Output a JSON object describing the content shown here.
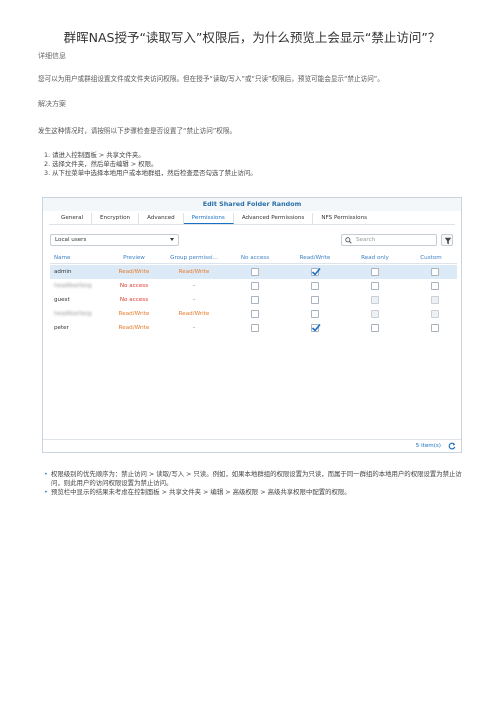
{
  "title": "群晖NAS授予“读取写入”权限后，为什么预览上会显示“禁止访问”？",
  "details_heading": "详细信息",
  "details_text": "您可以为用户或群组设置文件或文件夹访问权限。但在授予“读取/写入”或“只读”权限后，预览可能会显示“禁止访问”。",
  "solution_heading": "解决方案",
  "solution_text": "发生这种情况时，请按照以下步骤检查是否设置了“禁止访问”权限。",
  "steps": [
    "1. 请进入控制面板 > 共享文件夹。",
    "2. 选择文件夹，然后单击编辑 > 权限。",
    "3. 从下拉菜单中选择本地用户或本地群组，然后检查是否勾选了禁止访问。"
  ],
  "dialog": {
    "title": "Edit Shared Folder Random",
    "tabs": [
      "General",
      "Encryption",
      "Advanced",
      "Permissions",
      "Advanced Permissions",
      "NFS Permissions"
    ],
    "active_tab": "Permissions",
    "select_value": "Local users",
    "search_placeholder": "Search",
    "columns": [
      "Name",
      "Preview",
      "Group permissi...",
      "No access",
      "Read/Write",
      "Read only",
      "Custom"
    ],
    "rows": [
      {
        "name": "admin",
        "preview": "Read/Write",
        "group": "Read/Write",
        "no_access": false,
        "read_write": true,
        "read_only": false,
        "custom": false,
        "selected": true,
        "disabled": false
      },
      {
        "name": "headfearfang",
        "preview": "No access",
        "group": "-",
        "no_access": false,
        "read_write": false,
        "read_only": false,
        "custom": false,
        "selected": false,
        "disabled": false,
        "blurred": true
      },
      {
        "name": "guest",
        "preview": "No access",
        "group": "-",
        "no_access": false,
        "read_write": false,
        "read_only": false,
        "custom": false,
        "selected": false,
        "disabled": true
      },
      {
        "name": "headfearfang",
        "preview": "Read/Write",
        "group": "Read/Write",
        "no_access": false,
        "read_write": false,
        "read_only": false,
        "custom": false,
        "selected": false,
        "disabled": true,
        "blurred": true
      },
      {
        "name": "peter",
        "preview": "Read/Write",
        "group": "-",
        "no_access": false,
        "read_write": true,
        "read_only": false,
        "custom": false,
        "selected": false,
        "disabled": false
      }
    ],
    "items_count": "5 item(s)"
  },
  "bullets": [
    "权限级别的优先顺序为：禁止访问 > 读取/写入 > 只读。例如，如果本地群组的权限设置为只读，而属于同一群组的本地用户的权限设置为禁止访问，则此用户的访问权限设置为禁止访问。",
    "预览栏中显示的结果未考虑在控制面板 > 共享文件夹 > 编辑 > 高级权限 > 高级共享权限中配置的权限。"
  ],
  "colors": {
    "accent": "#1a6fc2",
    "read_write": "#e57a2a",
    "no_access": "#e03a2a",
    "selected_row": "#dceaf7"
  }
}
